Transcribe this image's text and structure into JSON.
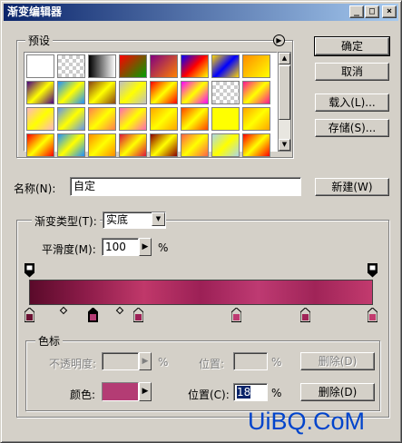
{
  "window": {
    "title": "渐变编辑器",
    "controls": [
      "minimize-icon",
      "maximize-icon",
      "close-icon"
    ]
  },
  "presets": {
    "label": "预设",
    "menu_icon": "circle-arrow-right-icon",
    "swatches": [
      [
        "#ffffff",
        "checker",
        "#000000",
        "#ff4500",
        "#ff8000",
        "#0000ff",
        "#ffd700",
        "#ff8c00"
      ],
      [
        "#4b0082",
        "#1e90ff",
        "#8b4513",
        "#c0c0c0",
        "#ff0000",
        "#ff00ff",
        "checker",
        "#ff1493"
      ],
      [
        "#ffb6c1",
        "#6495ed",
        "#ff7f50",
        "#ff69b4",
        "#ffa500",
        "#ff4500",
        "#ffff00",
        "#ffa500"
      ],
      [
        "#ff0000",
        "#1e90ff",
        "#ff8c00",
        "#dc143c",
        "#8b0000",
        "#ff6347",
        "#add8e6",
        "#ff0000"
      ]
    ]
  },
  "buttons": {
    "ok": "确定",
    "cancel": "取消",
    "load": "载入(L)...",
    "save": "存储(S)...",
    "new": "新建(W)"
  },
  "name": {
    "label": "名称(N):",
    "value": "自定"
  },
  "gradient": {
    "group_label": "渐变类型(T):",
    "type_value": "实底",
    "smoothness_label": "平滑度(M):",
    "smoothness_value": "100",
    "smoothness_unit": "%",
    "colors": [
      "#5a0a2a",
      "#8e1c4a",
      "#c0386a",
      "#9c2056",
      "#be3a72",
      "#a02458",
      "#c23a6e"
    ]
  },
  "stops": {
    "group_label": "色标",
    "opacity_label": "不透明度:",
    "opacity_unit": "%",
    "opacity_location_label": "位置:",
    "opacity_location_unit": "%",
    "opacity_delete": "删除(D)",
    "color_label": "颜色:",
    "color_value": "#b43c74",
    "color_location_label": "位置(C):",
    "color_location_value": "18",
    "color_location_unit": "%",
    "color_delete": "删除(D)"
  },
  "watermark": "UiBQ.CoM"
}
